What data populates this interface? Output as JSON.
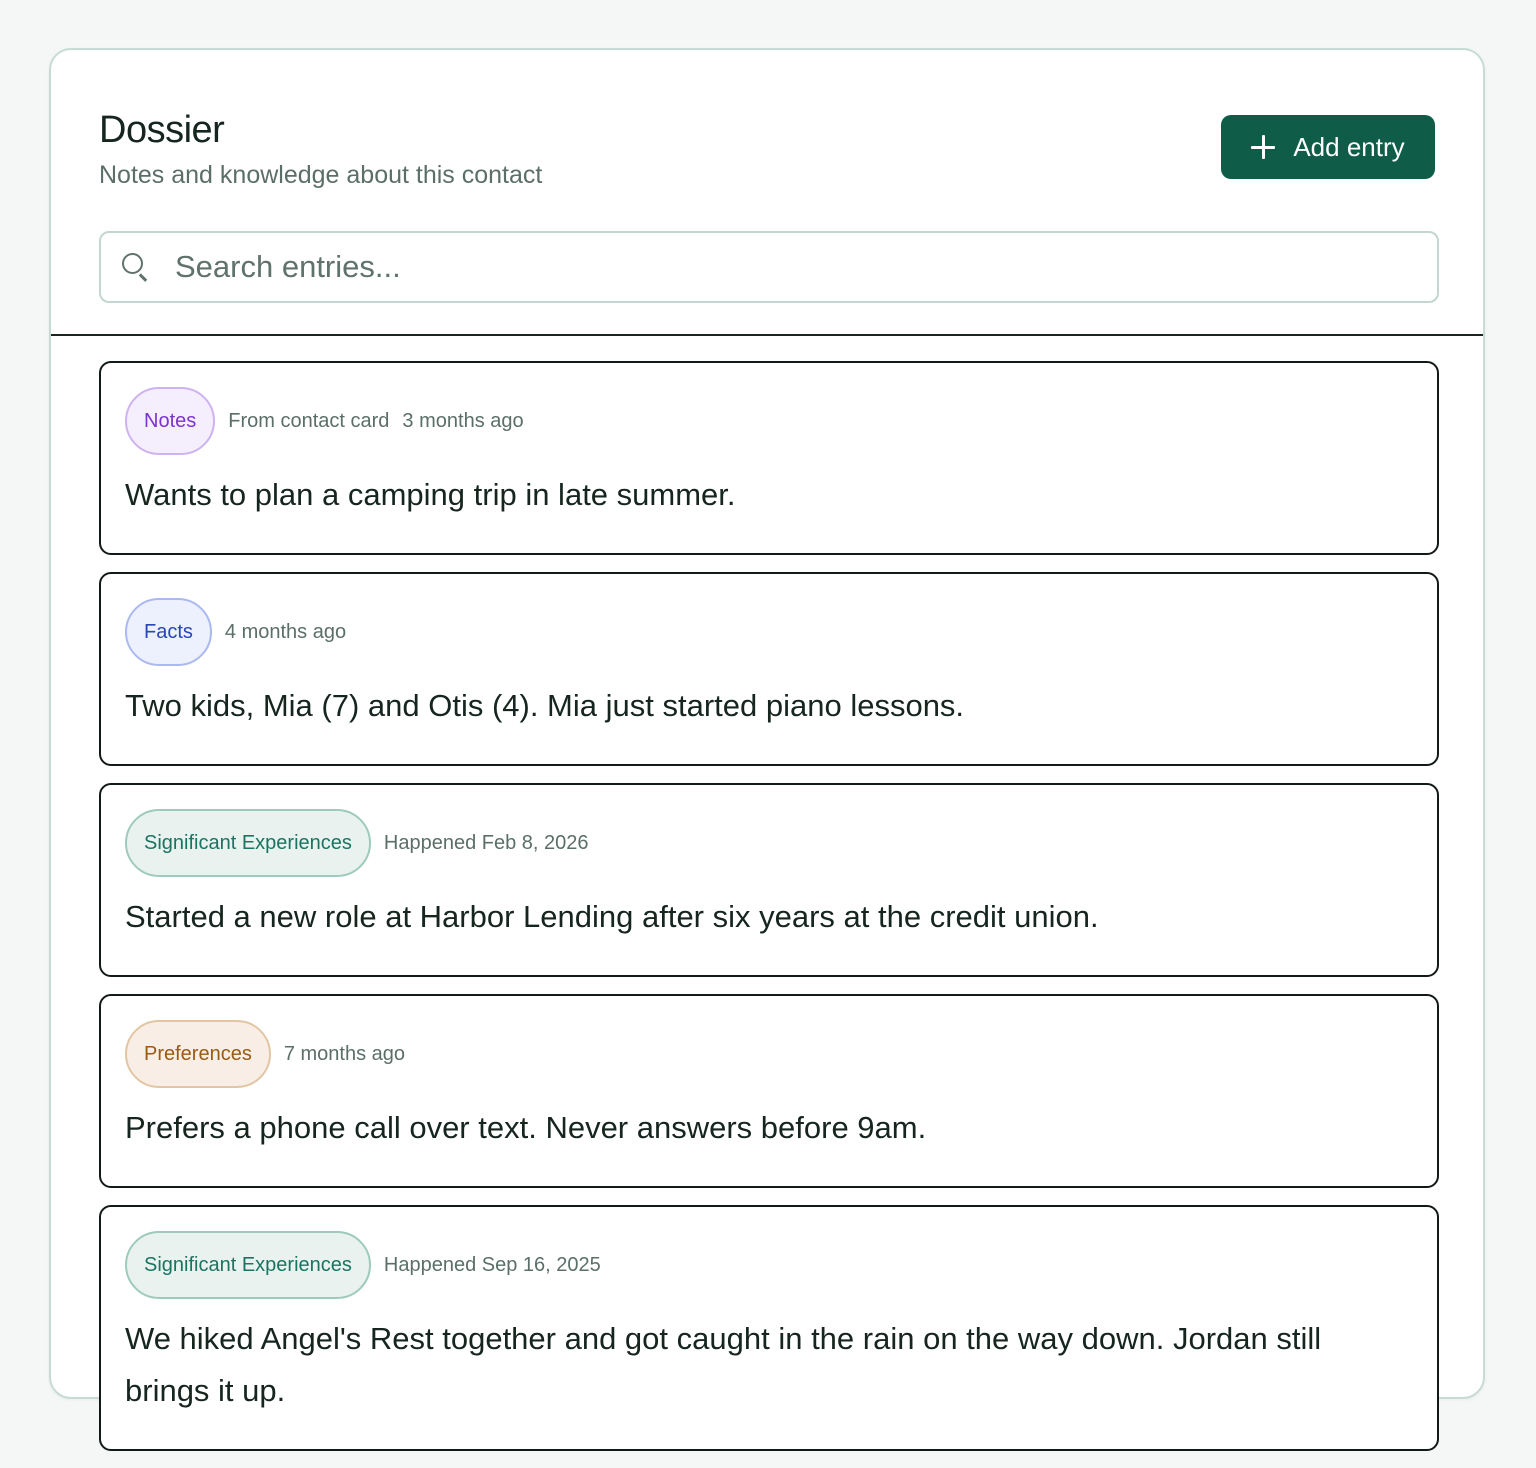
{
  "header": {
    "title": "Dossier",
    "subtitle": "Notes and knowledge about this contact",
    "add_label": "Add entry"
  },
  "search": {
    "placeholder": "Search entries..."
  },
  "entries": [
    {
      "category": "Notes",
      "source": "From contact card",
      "when": "3 months ago",
      "text": "Wants to plan a camping trip in late summer."
    },
    {
      "category": "Facts",
      "when": "4 months ago",
      "text": "Two kids, Mia (7) and Otis (4). Mia just started piano lessons."
    },
    {
      "category": "Significant Experiences",
      "when": "Happened Feb 8, 2026",
      "text": "Started a new role at Harbor Lending after six years at the credit union."
    },
    {
      "category": "Preferences",
      "when": "7 months ago",
      "text": "Prefers a phone call over text. Never answers before 9am."
    },
    {
      "category": "Significant Experiences",
      "when": "Happened Sep 16, 2025",
      "text": "We hiked Angel's Rest together and got caught in the rain on the way down. Jordan still brings it up."
    }
  ],
  "colors": {
    "accent": "#0f5d48",
    "notes_badge": "#7b33cf",
    "facts_badge": "#2846b8",
    "significant_badge": "#1a7462",
    "preferences_badge": "#9a5a12"
  }
}
